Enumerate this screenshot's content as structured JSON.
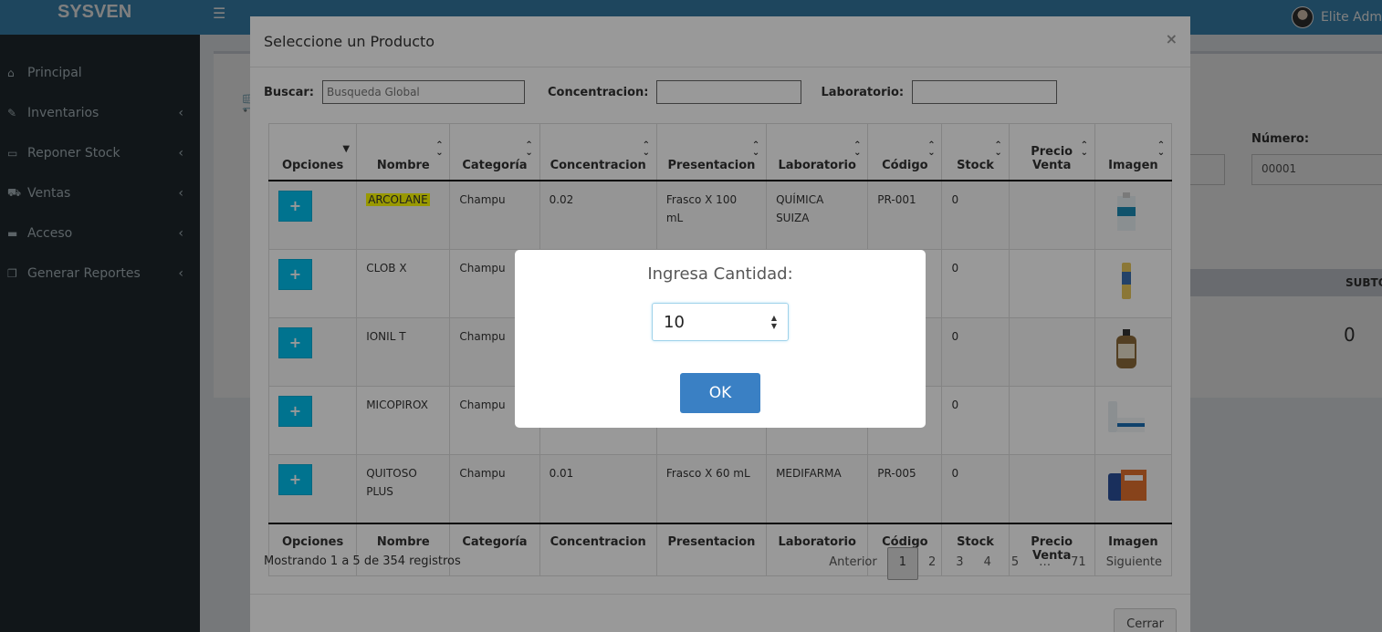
{
  "app": {
    "brand": "SYSVEN",
    "user_name": "Elite Adm"
  },
  "sidebar": {
    "items": [
      {
        "label": "Principal",
        "icon": "home-icon"
      },
      {
        "label": "Inventarios",
        "icon": "edit-icon"
      },
      {
        "label": "Reponer Stock",
        "icon": "laptop-icon"
      },
      {
        "label": "Ventas",
        "icon": "cart-icon"
      },
      {
        "label": "Acceso",
        "icon": "folder-icon"
      },
      {
        "label": "Generar Reportes",
        "icon": "copy-icon"
      }
    ]
  },
  "background": {
    "numero_label": "Número:",
    "numero_value": "00001",
    "subtotal_label": "SUBTOTA",
    "total_value": "0"
  },
  "modal": {
    "title": "Seleccione un Producto",
    "close_glyph": "×",
    "filters": {
      "buscar_label": "Buscar:",
      "buscar_placeholder": "Busqueda Global",
      "concentracion_label": "Concentracion:",
      "laboratorio_label": "Laboratorio:"
    },
    "columns": [
      "Opciones",
      "Nombre",
      "Categoría",
      "Concentracion",
      "Presentacion",
      "Laboratorio",
      "Código",
      "Stock",
      "Precio Venta",
      "Imagen"
    ],
    "rows": [
      {
        "nombre": "ARCOLANE",
        "categoria": "Champu",
        "concentracion": "0.02",
        "presentacion": "Frasco X 100 mL",
        "laboratorio": "QUÍMICA SUIZA",
        "codigo": "PR-001",
        "stock": "0",
        "precio": ""
      },
      {
        "nombre": "CLOB X",
        "categoria": "Champu",
        "concentracion": "",
        "presentacion": "",
        "laboratorio": "",
        "codigo": "",
        "stock": "0",
        "precio": ""
      },
      {
        "nombre": "IONIL T",
        "categoria": "Champu",
        "concentracion": "",
        "presentacion": "",
        "laboratorio": "",
        "codigo": "",
        "stock": "0",
        "precio": ""
      },
      {
        "nombre": "MICOPIROX",
        "categoria": "Champu",
        "concentracion": "",
        "presentacion": "",
        "laboratorio": "",
        "codigo": "",
        "stock": "0",
        "precio": ""
      },
      {
        "nombre": "QUITOSO PLUS",
        "categoria": "Champu",
        "concentracion": "0.01",
        "presentacion": "Frasco X 60 mL",
        "laboratorio": "MEDIFARMA",
        "codigo": "PR-005",
        "stock": "0",
        "precio": ""
      }
    ],
    "info": "Mostrando 1 a 5 de 354 registros",
    "pagination": {
      "prev": "Anterior",
      "pages": [
        "1",
        "2",
        "3",
        "4",
        "5",
        "…",
        "71"
      ],
      "next": "Siguiente",
      "active": "1"
    },
    "close_button": "Cerrar"
  },
  "dialog": {
    "title": "Ingresa Cantidad:",
    "value": "10",
    "ok_label": "OK"
  },
  "colors": {
    "topbar": "#3c8dbc",
    "sidebar": "#222d32",
    "add_button": "#00c0ef",
    "ok_button": "#3a80c4",
    "highlight": "#ffff00"
  }
}
